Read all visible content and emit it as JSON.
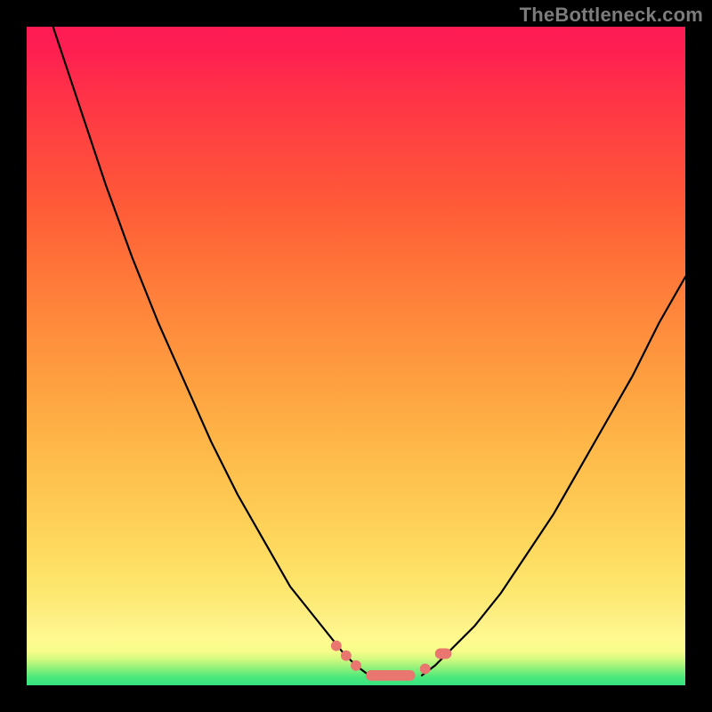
{
  "watermark": "TheBottleneck.com",
  "colors": {
    "frame": "#000000",
    "curve": "#000000",
    "marker": "#e9766f",
    "watermark_text": "#7c7c7c"
  },
  "chart_data": {
    "type": "line",
    "title": "",
    "xlabel": "",
    "ylabel": "",
    "xlim": [
      0,
      100
    ],
    "ylim": [
      0,
      100
    ],
    "legend": false,
    "grid": false,
    "series": [
      {
        "name": "left-curve",
        "x": [
          4,
          8,
          12,
          16,
          20,
          24,
          28,
          32,
          36,
          40,
          44,
          48,
          50,
          52
        ],
        "y": [
          100,
          88,
          76,
          65,
          55,
          46,
          37,
          29,
          22,
          15,
          10,
          5,
          3,
          1.5
        ]
      },
      {
        "name": "right-curve",
        "x": [
          60,
          62,
          64,
          68,
          72,
          76,
          80,
          84,
          88,
          92,
          96,
          100
        ],
        "y": [
          1.5,
          3,
          5,
          9,
          14,
          20,
          26,
          33,
          40,
          47,
          55,
          62
        ]
      }
    ],
    "markers": [
      {
        "type": "point",
        "x": 47,
        "y": 6,
        "r": 0.8
      },
      {
        "type": "point",
        "x": 48.5,
        "y": 4.5,
        "r": 0.8
      },
      {
        "type": "point",
        "x": 50,
        "y": 3,
        "r": 0.8
      },
      {
        "type": "bar",
        "x_start": 51.5,
        "x_end": 59,
        "y": 1.5,
        "thickness": 1.6
      },
      {
        "type": "point",
        "x": 60.5,
        "y": 2.5,
        "r": 0.8
      },
      {
        "type": "bar",
        "x_start": 62.0,
        "x_end": 64.5,
        "y": 4.8,
        "thickness": 1.6
      }
    ]
  }
}
